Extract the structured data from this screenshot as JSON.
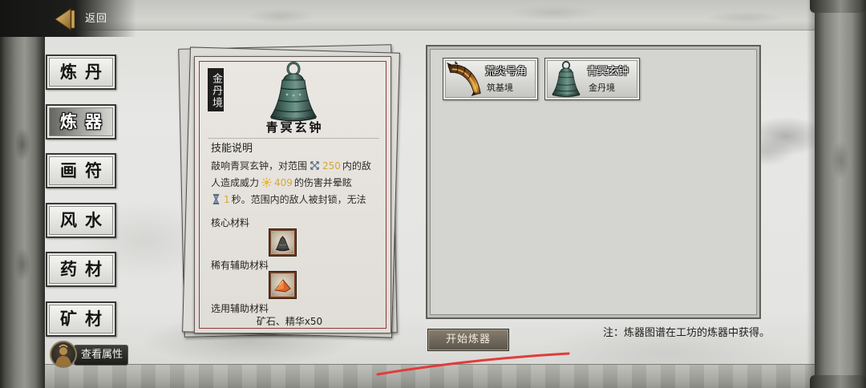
{
  "header": {
    "back_label": "返回",
    "back_icon": "back-arrow-icon"
  },
  "tabs": [
    {
      "label": "炼丹",
      "selected": false
    },
    {
      "label": "炼器",
      "selected": true
    },
    {
      "label": "画符",
      "selected": false
    },
    {
      "label": "风水",
      "selected": false
    },
    {
      "label": "药材",
      "selected": false
    },
    {
      "label": "矿材",
      "selected": false
    }
  ],
  "profile": {
    "avatar_icon": "character-avatar-icon",
    "view_attributes_label": "查看属性"
  },
  "detail": {
    "realm": "金丹境",
    "item_name": "青冥玄钟",
    "item_icon": "bronze-bell-icon",
    "skill_heading": "技能说明",
    "skill_lines": [
      [
        {
          "text": "敲响青冥玄钟，对范围"
        },
        {
          "icon": "range-icon"
        },
        {
          "value": 250
        },
        {
          "text": "内的敌"
        }
      ],
      [
        {
          "text": "人造成威力"
        },
        {
          "icon": "power-icon"
        },
        {
          "value": 409
        },
        {
          "text": "的伤害并晕眩"
        }
      ],
      [
        {
          "icon": "hourglass-icon"
        },
        {
          "value": 1
        },
        {
          "text": "秒。范围内的敌人被封锁，无法"
        }
      ]
    ],
    "core_material_label": "核心材料",
    "core_material_icon": "bell-ore-icon",
    "rare_material_label": "稀有辅助材料",
    "rare_material_icon": "flame-shard-icon",
    "optional_material_label": "选用辅助材料",
    "optional_material_value": "矿石、精华x50"
  },
  "recipes": [
    {
      "name": "荒炎号角",
      "realm": "筑基境",
      "icon": "horn-icon"
    },
    {
      "name": "青冥玄钟",
      "realm": "金丹境",
      "icon": "bronze-bell-icon"
    }
  ],
  "actions": {
    "start_label": "开始炼器"
  },
  "note": "注：炼器图谱在工坊的炼器中获得。",
  "colors": {
    "highlight_number": "#d4a835",
    "card_border": "#8f3a3a",
    "annotation_stroke": "#e23b3b"
  }
}
